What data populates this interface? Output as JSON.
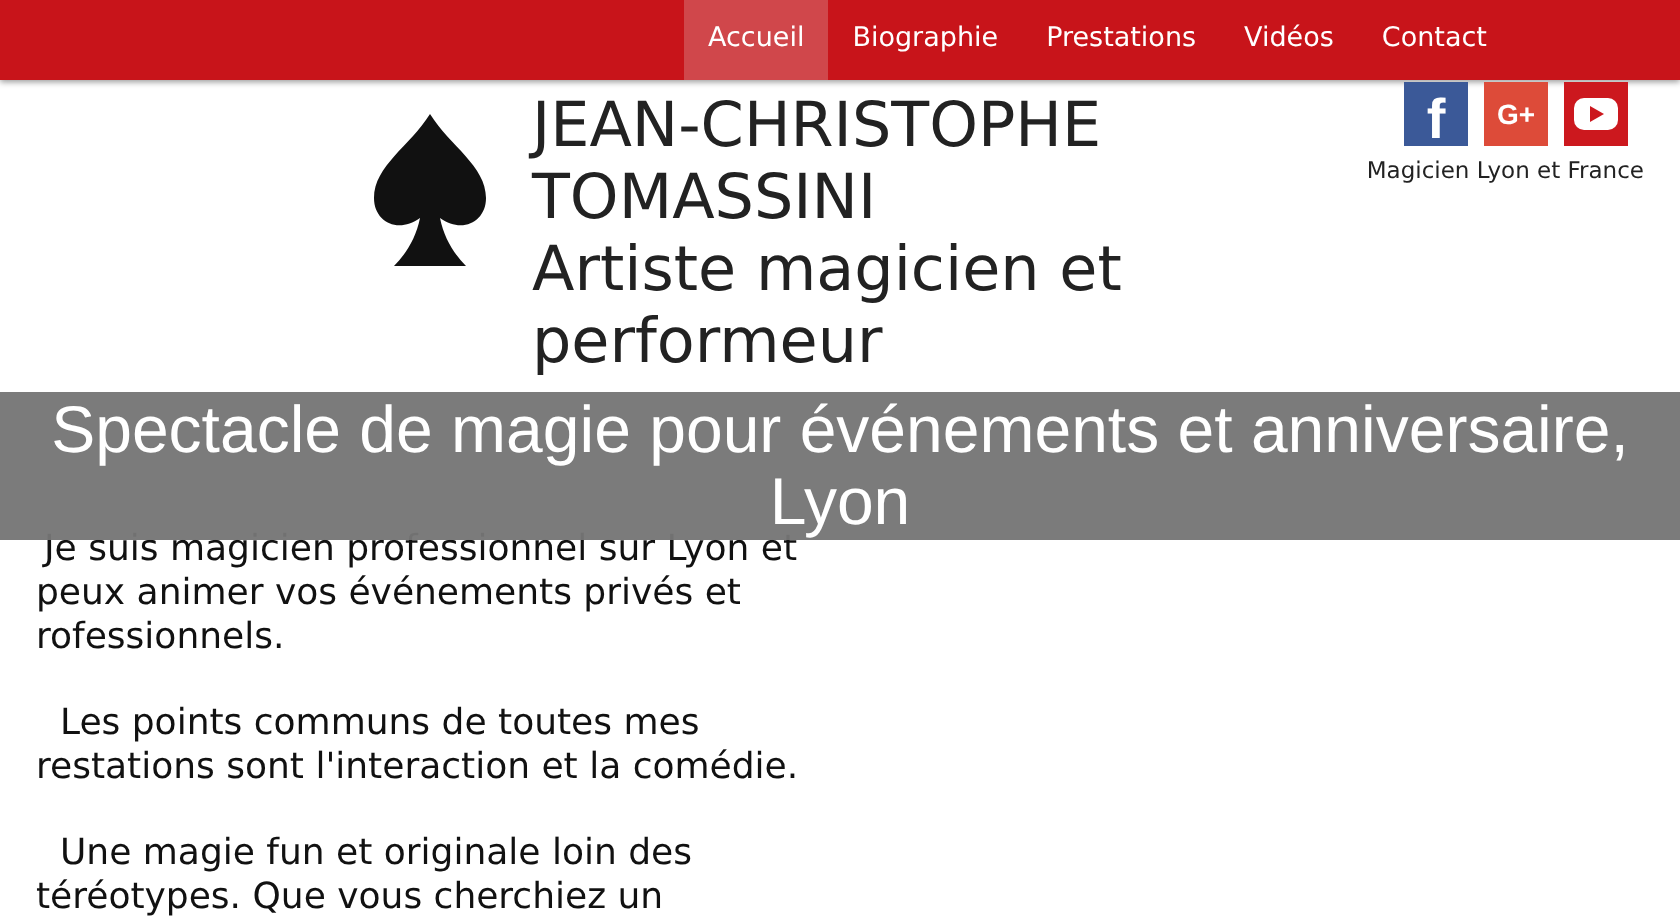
{
  "nav": {
    "items": [
      {
        "label": "Accueil",
        "selected": true
      },
      {
        "label": "Biographie",
        "selected": false
      },
      {
        "label": "Prestations",
        "selected": false
      },
      {
        "label": "Vidéos",
        "selected": false
      },
      {
        "label": "Contact",
        "selected": false
      }
    ]
  },
  "header": {
    "title_lines": [
      "JEAN-CHRISTOPHE",
      "TOMASSINI"
    ],
    "subtitle_lines": [
      "Artiste magicien et",
      "performeur"
    ],
    "social": [
      {
        "kind": "facebook",
        "glyph": "f"
      },
      {
        "kind": "googleplus",
        "glyph": "G+"
      },
      {
        "kind": "youtube"
      }
    ],
    "tagline": "Magicien Lyon et France"
  },
  "paragraphs": [
    [
      "Je suis magicien professionnel sur Lyon et",
      "peux animer vos événements privés et",
      "rofessionnels."
    ],
    [
      "Les points communs de toutes mes",
      "restations sont l'interaction et la comédie."
    ],
    [
      "Une magie fun et originale loin des",
      "téréotypes. Que vous cherchiez un"
    ]
  ],
  "overlay": {
    "caption": "Spectacle de magie pour événements et anniversaire, Lyon"
  }
}
